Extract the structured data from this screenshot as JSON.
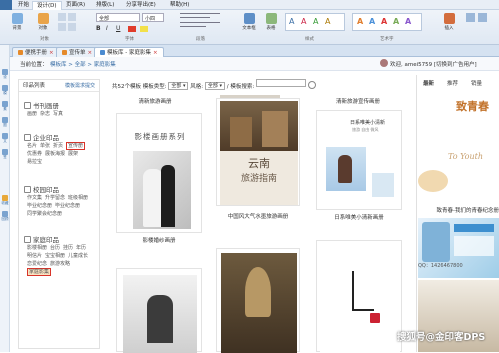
{
  "ribbon": {
    "tabs": [
      "开始",
      "设计(D)",
      "页面(R)",
      "排版(L)",
      "分享导出(E)",
      "帮助(H)"
    ],
    "active_tab": 1,
    "tools": [
      "背景",
      "对象",
      "",
      "文本框",
      "表格",
      "文字样式",
      "艺术字",
      "插入"
    ],
    "groups": [
      "对象",
      "字体",
      "段落",
      "样式",
      "艺术字"
    ]
  },
  "doc_tabs": [
    "便携手册",
    "宣传单",
    "模板库 - 家庭影集"
  ],
  "address": {
    "prefix": "当前位置：",
    "crumbs": "模板库 > 全部 > 家庭影集",
    "user": "欢迎, amei5759 [切换到广告用户]"
  },
  "side_icons": [
    "设",
    "模",
    "素",
    "图",
    "文",
    "签",
    "收藏",
    "回顾"
  ],
  "left_panel": {
    "header": "印品列表",
    "header_more": "模板需求提交",
    "categories": [
      {
        "title": "书刊画册",
        "tags": [
          "画册",
          "杂志",
          "写真"
        ]
      },
      {
        "title": "企业印品",
        "tags": [
          "名片",
          "单张",
          "折页",
          "宣传册",
          "优惠券",
          "展板海报",
          "展架",
          "易拉宝"
        ]
      },
      {
        "title": "校园印品",
        "tags": [
          "作文集",
          "升学留念",
          "班级相册",
          "毕业纪念册",
          "毕业纪念册",
          "同学聚会纪念册"
        ]
      },
      {
        "title": "家庭印品",
        "tags": [
          "影楼相册",
          "台历",
          "挂历",
          "年历",
          "明信片",
          "宝宝相册",
          "儿童成长",
          "恋爱纪念",
          "旅游攻略",
          "家庭影集"
        ]
      }
    ]
  },
  "filter": {
    "count_text": "共52个模板",
    "label1": "模板类型:",
    "sel1": "全部",
    "label2": "风格:",
    "sel2": "全部",
    "label3": "/ 模板搜索:"
  },
  "templates": [
    {
      "caption": "清新旅游画册"
    },
    {
      "caption": "影楼婚纱画册",
      "title": "影楼画册系列"
    },
    {
      "caption": "中国风大气水墨旅游画册",
      "title": "云南",
      "subtitle": "旅游指南"
    },
    {
      "caption": "日系唯美小清新画册",
      "title": "日系唯美小清新",
      "subtitle": "旅游 自由 微风"
    },
    {
      "caption": "清新旅游宣传画册"
    }
  ],
  "right_panel": {
    "tabs": [
      "最新",
      "推荐",
      "销量"
    ],
    "card1": {
      "title": "致青春",
      "caption": "致青春-我们的青春纪念册",
      "script": "To Youth"
    },
    "card2": {
      "phone": "QQ：1426467800"
    },
    "watermark": "搜狐号@金印客DPS"
  },
  "colors": {
    "accent": "#3a6ea5",
    "highlight": "#d8342a",
    "tab_bg": "#d5e2f1"
  }
}
